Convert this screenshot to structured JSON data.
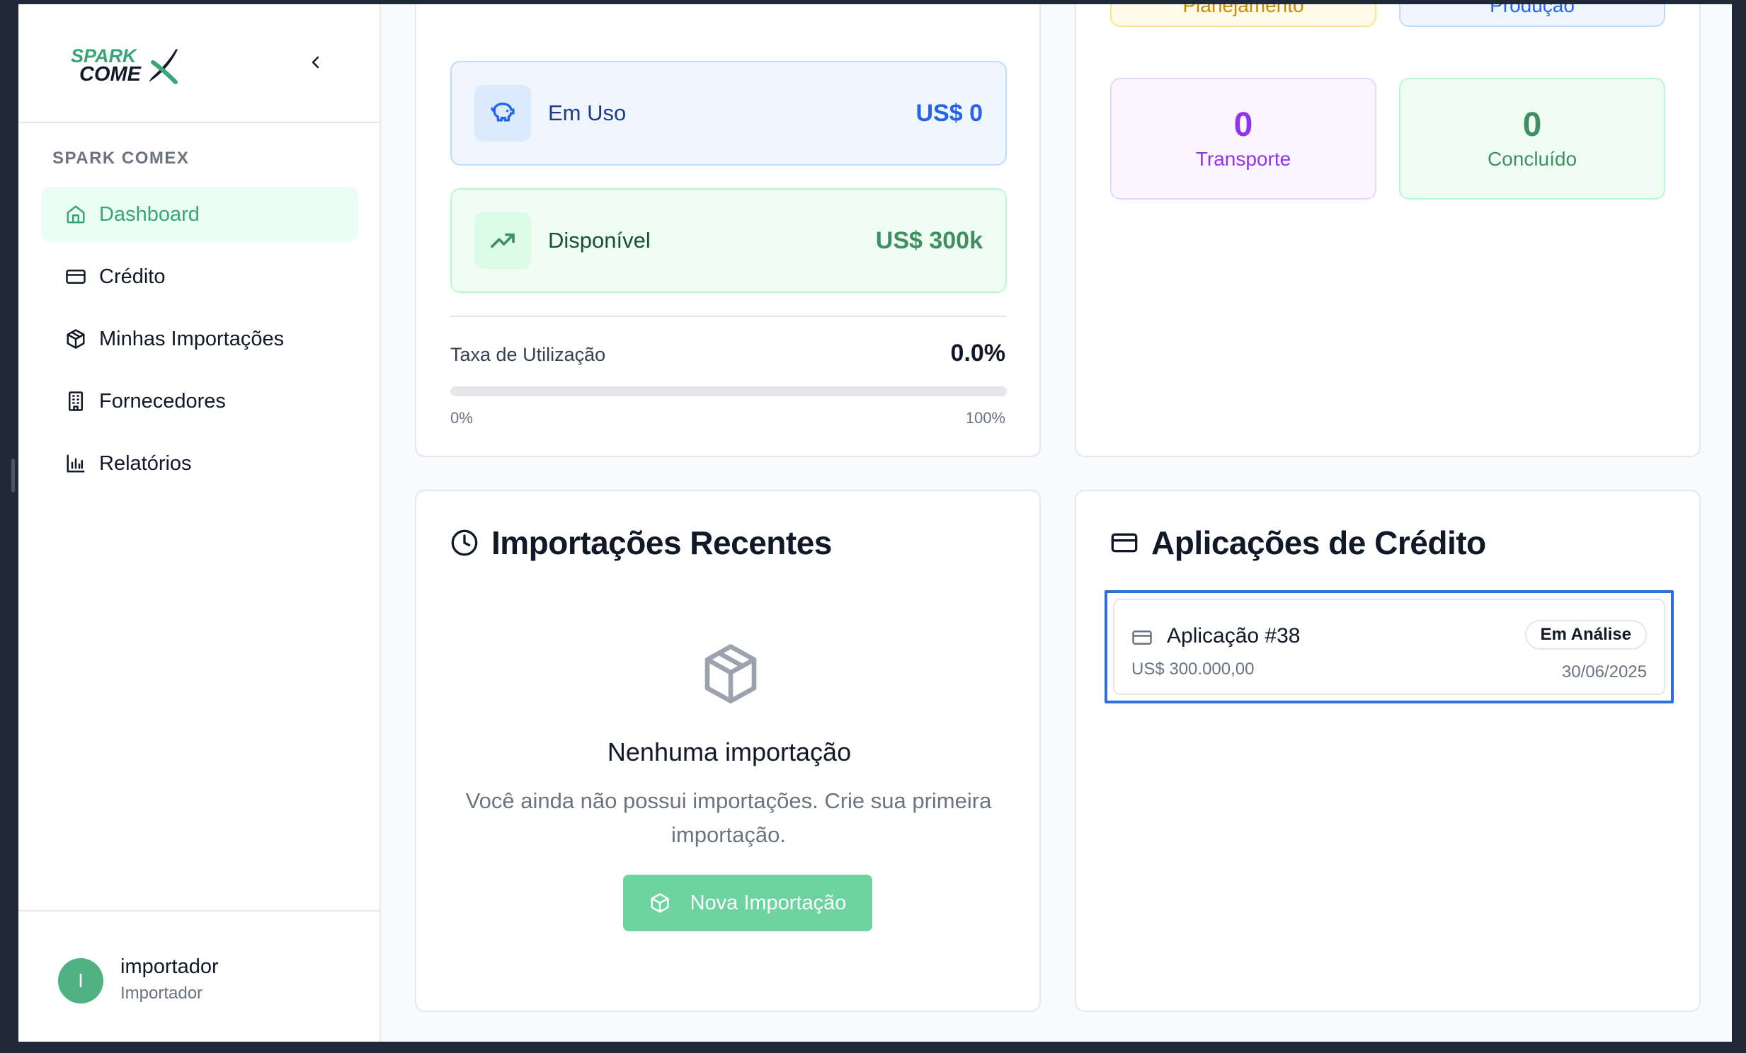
{
  "sidebar": {
    "brand": "SPARK COMEX",
    "section_label": "SPARK COMEX",
    "items": [
      {
        "label": "Dashboard",
        "icon": "home-icon"
      },
      {
        "label": "Crédito",
        "icon": "credit-card-icon"
      },
      {
        "label": "Minhas Importações",
        "icon": "package-icon"
      },
      {
        "label": "Fornecedores",
        "icon": "building-icon"
      },
      {
        "label": "Relatórios",
        "icon": "bar-chart-icon"
      }
    ],
    "active_item": "Dashboard",
    "user": {
      "initial": "I",
      "name": "importador",
      "role": "Importador"
    }
  },
  "credit_summary": {
    "in_use": {
      "label": "Em Uso",
      "value": "US$ 0",
      "icon": "piggy-bank-icon"
    },
    "available": {
      "label": "Disponível",
      "value": "US$ 300k",
      "icon": "trending-up-icon"
    },
    "utilization": {
      "label": "Taxa de Utilização",
      "value": "0.0%",
      "fraction": 0.0,
      "min_label": "0%",
      "max_label": "100%"
    }
  },
  "import_status": {
    "planning": {
      "label": "Planejamento"
    },
    "production": {
      "label": "Produção"
    },
    "transport": {
      "count": "0",
      "label": "Transporte"
    },
    "completed": {
      "count": "0",
      "label": "Concluído"
    }
  },
  "recent_imports": {
    "title": "Importações Recentes",
    "empty_title": "Nenhuma importação",
    "empty_description": "Você ainda não possui importações. Crie sua primeira importação.",
    "button_label": "Nova Importação"
  },
  "credit_applications": {
    "title": "Aplicações de Crédito",
    "items": [
      {
        "name": "Aplicação #38",
        "amount": "US$ 300.000,00",
        "status": "Em Análise",
        "date": "30/06/2025"
      }
    ]
  },
  "colors": {
    "accent": "#3aa57a",
    "button": "#6dd3a0",
    "blue": "#2563eb",
    "purple": "#9333ea",
    "yellow": "#ca8a04"
  }
}
